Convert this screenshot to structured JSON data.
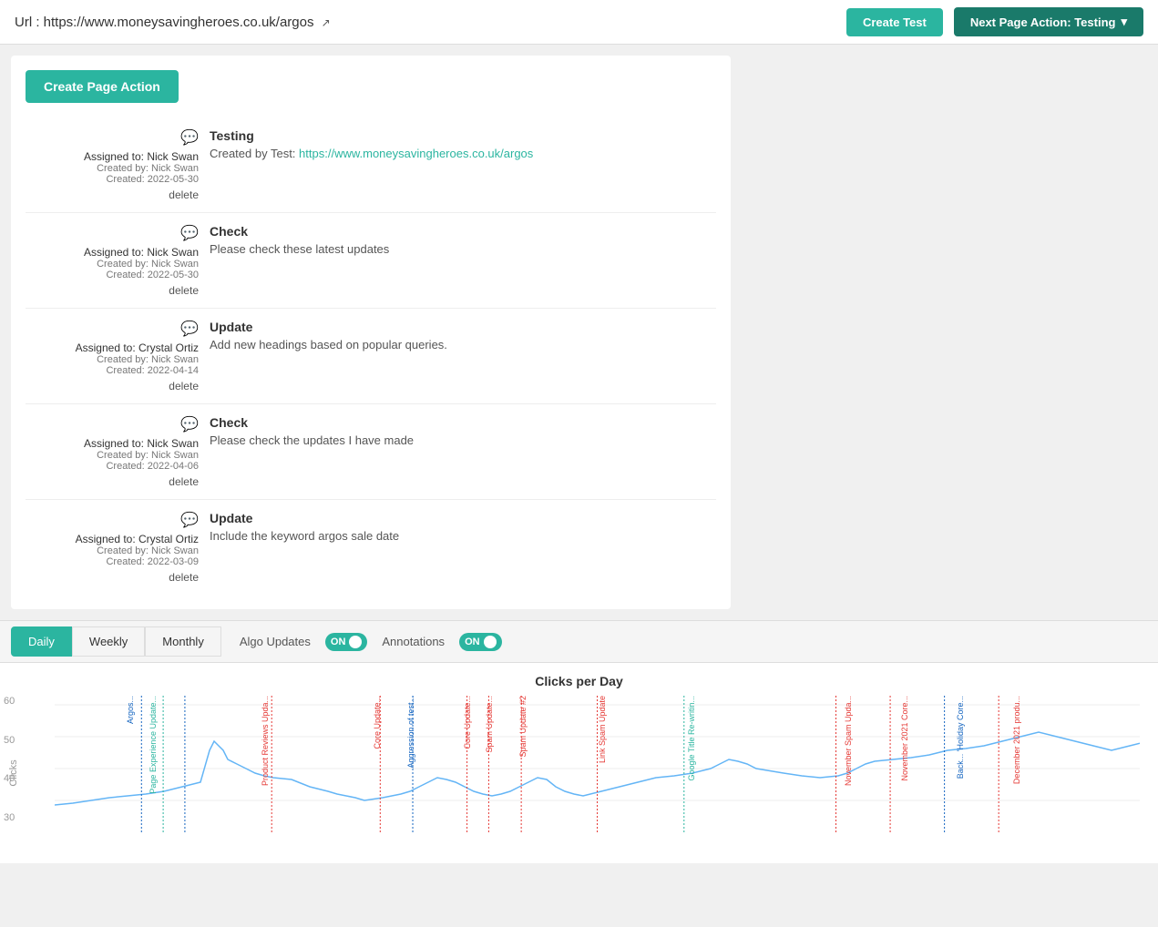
{
  "header": {
    "url_label": "Url : https://www.moneysavingheroes.co.uk/argos",
    "url_href": "https://www.moneysavingheroes.co.uk/argos",
    "create_test_label": "Create Test",
    "next_page_action_label": "Next Page Action: Testing"
  },
  "create_page_action_label": "Create Page Action",
  "actions": [
    {
      "comment_icon": "💬",
      "assigned": "Assigned to: Nick Swan",
      "created_by": "Created by: Nick Swan",
      "created_date": "Created: 2022-05-30",
      "delete_label": "delete",
      "title": "Testing",
      "desc": "Created by Test: https://www.moneysavingheroes.co.uk/argos",
      "desc_link": "https://www.moneysavingheroes.co.uk/argos"
    },
    {
      "comment_icon": "💬",
      "assigned": "Assigned to: Nick Swan",
      "created_by": "Created by: Nick Swan",
      "created_date": "Created: 2022-05-30",
      "delete_label": "delete",
      "title": "Check",
      "desc": "Please check these latest updates",
      "desc_link": null
    },
    {
      "comment_icon": "💬",
      "assigned": "Assigned to: Crystal Ortiz",
      "created_by": "Created by: Nick Swan",
      "created_date": "Created: 2022-04-14",
      "delete_label": "delete",
      "title": "Update",
      "desc": "Add new headings based on popular queries.",
      "desc_link": null
    },
    {
      "comment_icon": "💬",
      "assigned": "Assigned to: Nick Swan",
      "created_by": "Created by: Nick Swan",
      "created_date": "Created: 2022-04-06",
      "delete_label": "delete",
      "title": "Check",
      "desc": "Please check the updates I have made",
      "desc_link": null
    },
    {
      "comment_icon": "💬",
      "assigned": "Assigned to: Crystal Ortiz",
      "created_by": "Created by: Nick Swan",
      "created_date": "Created: 2022-03-09",
      "delete_label": "delete",
      "title": "Update",
      "desc": "Include the keyword argos sale date",
      "desc_link": null
    }
  ],
  "tabs": {
    "daily": "Daily",
    "weekly": "Weekly",
    "monthly": "Monthly"
  },
  "toggles": {
    "algo_updates": "Algo Updates",
    "annotations": "Annotations",
    "on_label": "ON"
  },
  "chart": {
    "title": "Clicks per Day",
    "y_axis_labels": [
      "60",
      "50",
      "40",
      "30"
    ],
    "y_axis_side": "Clicks"
  },
  "algo_annotations": [
    {
      "label": "Argos...",
      "color": "#1565c0",
      "x_pct": 8
    },
    {
      "label": "Page Experience Update...",
      "color": "#2bb5a0",
      "x_pct": 10
    },
    {
      "label": "Product Reviews Upda...",
      "color": "#e53935",
      "x_pct": 20
    },
    {
      "label": "Core Update...",
      "color": "#e53935",
      "x_pct": 30
    },
    {
      "label": "Aggression of test...",
      "color": "#1565c0",
      "x_pct": 33
    },
    {
      "label": "Core Update...",
      "color": "#e53935",
      "x_pct": 38
    },
    {
      "label": "Spam Update...",
      "color": "#e53935",
      "x_pct": 40
    },
    {
      "label": "Spam Update #2",
      "color": "#e53935",
      "x_pct": 43
    },
    {
      "label": "Link Spam Update",
      "color": "#e53935",
      "x_pct": 50
    },
    {
      "label": "Google Title Re-writin...",
      "color": "#2bb5a0",
      "x_pct": 58
    },
    {
      "label": "November Spam Upda...",
      "color": "#e53935",
      "x_pct": 72
    },
    {
      "label": "November 2021 Core...",
      "color": "#e53935",
      "x_pct": 77
    },
    {
      "label": "Back... 'Holiday Core...",
      "color": "#1565c0",
      "x_pct": 82
    },
    {
      "label": "December 2021 produ...",
      "color": "#e53935",
      "x_pct": 87
    }
  ]
}
